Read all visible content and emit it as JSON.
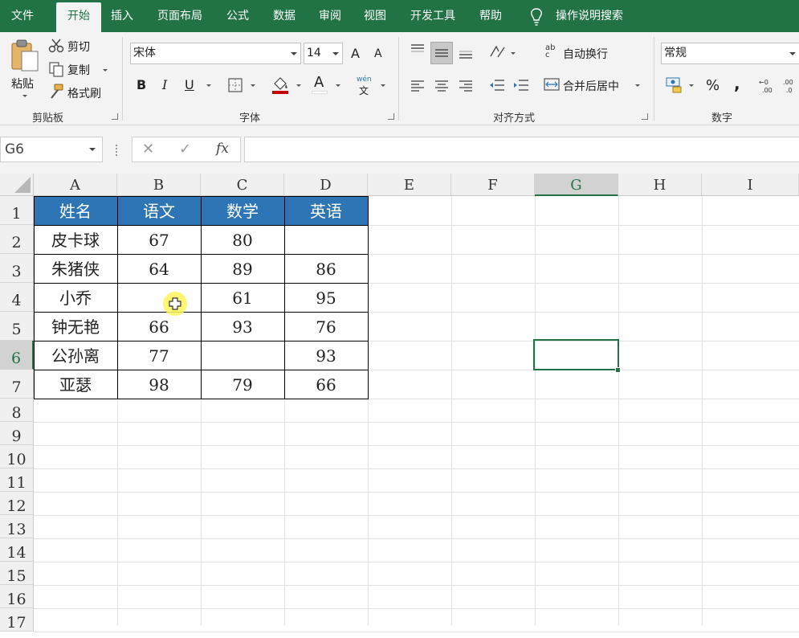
{
  "menu": {
    "tabs": [
      "文件",
      "开始",
      "插入",
      "页面布局",
      "公式",
      "数据",
      "审阅",
      "视图",
      "开发工具",
      "帮助"
    ],
    "search": "操作说明搜索"
  },
  "ribbon": {
    "clipboard": {
      "paste": "粘贴",
      "cut": "剪切",
      "copy": "复制",
      "format_painter": "格式刷",
      "label": "剪贴板"
    },
    "font": {
      "name": "宋体",
      "size": "14",
      "bold": "B",
      "italic": "I",
      "underline": "U",
      "font_color_glyph": "A",
      "grow": "A",
      "shrink": "A",
      "phonetic_top": "wén",
      "phonetic_bottom": "文",
      "label": "字体"
    },
    "alignment": {
      "wrap_text": "自动换行",
      "wrap_glyph": "ab\nc",
      "merge_center": "合并后居中",
      "label": "对齐方式"
    },
    "number": {
      "format": "常规",
      "percent": "%",
      "comma": ",",
      "label": "数字"
    }
  },
  "formula_bar": {
    "name_box": "G6",
    "fx": "fx",
    "cancel": "✕",
    "enter": "✓",
    "formula": ""
  },
  "columns": [
    "A",
    "B",
    "C",
    "D",
    "E",
    "F",
    "G",
    "H",
    "I"
  ],
  "rows": [
    "1",
    "2",
    "3",
    "4",
    "5",
    "6",
    "7",
    "8",
    "9",
    "10",
    "11",
    "12",
    "13",
    "14",
    "15",
    "16",
    "17"
  ],
  "table": {
    "headers": [
      "姓名",
      "语文",
      "数学",
      "英语"
    ],
    "rows": [
      [
        "皮卡球",
        "67",
        "80",
        ""
      ],
      [
        "朱猪侠",
        "64",
        "89",
        "86"
      ],
      [
        "小乔",
        "",
        "61",
        "95"
      ],
      [
        "钟无艳",
        "66",
        "93",
        "76"
      ],
      [
        "公孙离",
        "77",
        "",
        "93"
      ],
      [
        "亚瑟",
        "98",
        "79",
        "66"
      ]
    ]
  },
  "colors": {
    "brand": "#217346",
    "header_fill": "#2e75b6",
    "cursor_highlight": "#fff45c"
  },
  "selected_cell": "G6"
}
